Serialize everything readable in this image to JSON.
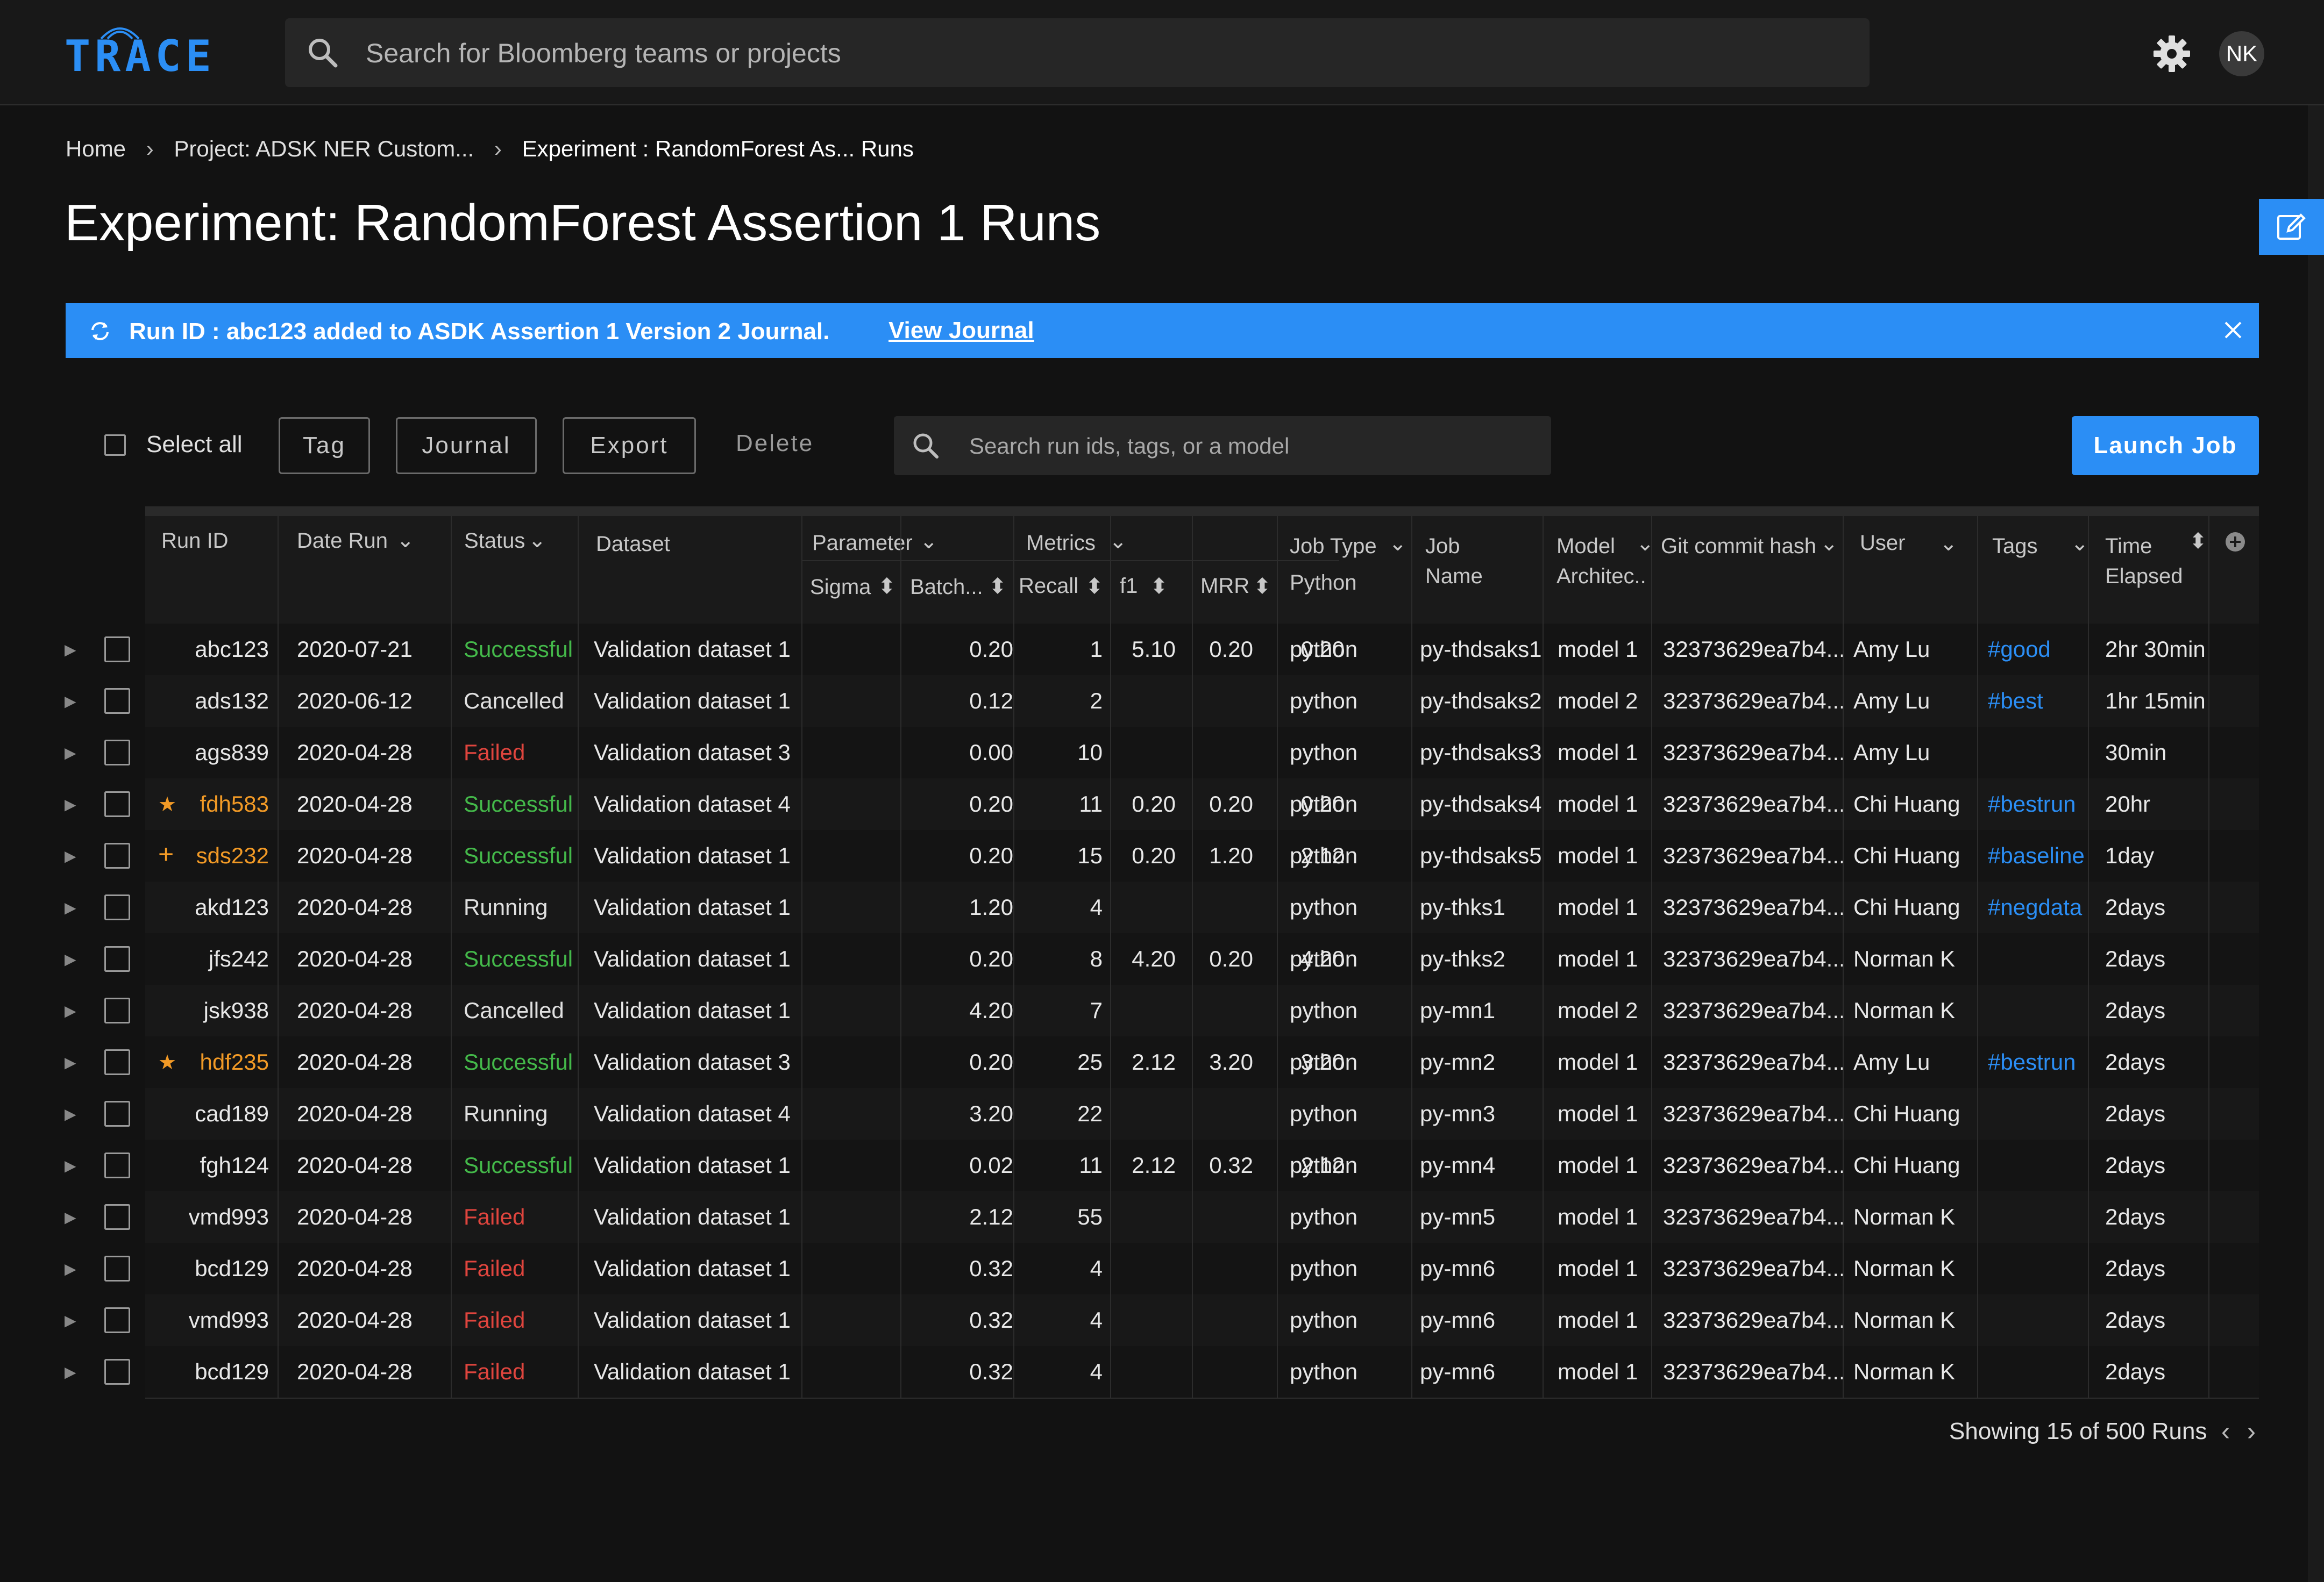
{
  "app": {
    "logo": "TRACE",
    "search_placeholder": "Search for Bloomberg teams or projects",
    "user_initials": "NK"
  },
  "breadcrumb": {
    "home": "Home",
    "project": "Project: ADSK NER Custom...",
    "experiment": "Experiment : RandomForest As... Runs"
  },
  "page": {
    "title": "Experiment: RandomForest Assertion 1 Runs"
  },
  "banner": {
    "message": "Run ID : abc123 added to ASDK Assertion 1 Version 2 Journal.",
    "link": "View Journal"
  },
  "toolbar": {
    "select_all": "Select all",
    "tag": "Tag",
    "journal": "Journal",
    "export": "Export",
    "delete": "Delete",
    "search_placeholder": "Search run ids, tags, or a model",
    "launch": "Launch Job"
  },
  "columns": {
    "run_id": "Run ID",
    "date_run": "Date Run",
    "status": "Status",
    "dataset": "Dataset",
    "parameter": "Parameter",
    "sigma": "Sigma",
    "batch": "Batch...",
    "metrics": "Metrics",
    "recall": "Recall",
    "f1": "f1",
    "mrr": "MRR",
    "job_type": "Job Type",
    "job_type_sub": "Python",
    "job_name_1": "Job",
    "job_name_2": "Name",
    "model_1": "Model",
    "model_2": "Architec..",
    "git": "Git commit hash",
    "user": "User",
    "tags": "Tags",
    "time_1": "Time",
    "time_2": "Elapsed"
  },
  "rows": [
    {
      "run_id": "abc123",
      "marker": "",
      "date": "2020-07-21",
      "status": "Successful",
      "status_kind": "success",
      "dataset": "Validation dataset 1",
      "sigma": "0.20",
      "batch": "1",
      "recall": "5.10",
      "f1": "0.20",
      "mrr": "0.20",
      "job_type": "python",
      "job_name": "py-thdsaks1",
      "model": "model 1",
      "git": "32373629ea7b4...",
      "user": "Amy Lu",
      "tag": "#good",
      "time": "2hr 30min"
    },
    {
      "run_id": "ads132",
      "marker": "",
      "date": "2020-06-12",
      "status": "Cancelled",
      "status_kind": "cancel",
      "dataset": "Validation dataset 1",
      "sigma": "0.12",
      "batch": "2",
      "recall": "",
      "f1": "",
      "mrr": "",
      "job_type": "python",
      "job_name": "py-thdsaks2",
      "model": "model 2",
      "git": "32373629ea7b4...",
      "user": "Amy Lu",
      "tag": "#best",
      "time": "1hr 15min"
    },
    {
      "run_id": "ags839",
      "marker": "",
      "date": "2020-04-28",
      "status": "Failed",
      "status_kind": "failed",
      "dataset": "Validation dataset 3",
      "sigma": "0.00",
      "batch": "10",
      "recall": "",
      "f1": "",
      "mrr": "",
      "job_type": "python",
      "job_name": "py-thdsaks3",
      "model": "model 1",
      "git": "32373629ea7b4...",
      "user": "Amy Lu",
      "tag": "",
      "time": "30min"
    },
    {
      "run_id": "fdh583",
      "marker": "★",
      "date": "2020-04-28",
      "status": "Successful",
      "status_kind": "success",
      "dataset": "Validation dataset 4",
      "sigma": "0.20",
      "batch": "11",
      "recall": "0.20",
      "f1": "0.20",
      "mrr": "0.20",
      "job_type": "python",
      "job_name": "py-thdsaks4",
      "model": "model 1",
      "git": "32373629ea7b4...",
      "user": "Chi Huang",
      "tag": "#bestrun",
      "time": "20hr"
    },
    {
      "run_id": "sds232",
      "marker": "+",
      "date": "2020-04-28",
      "status": "Successful",
      "status_kind": "success",
      "dataset": "Validation dataset 1",
      "sigma": "0.20",
      "batch": "15",
      "recall": "0.20",
      "f1": "1.20",
      "mrr": "2.12",
      "job_type": "python",
      "job_name": "py-thdsaks5",
      "model": "model 1",
      "git": "32373629ea7b4...",
      "user": "Chi Huang",
      "tag": "#baseline",
      "time": "1day"
    },
    {
      "run_id": "akd123",
      "marker": "",
      "date": "2020-04-28",
      "status": "Running",
      "status_kind": "run",
      "dataset": "Validation dataset 1",
      "sigma": "1.20",
      "batch": "4",
      "recall": "",
      "f1": "",
      "mrr": "",
      "job_type": "python",
      "job_name": "py-thks1",
      "model": "model 1",
      "git": "32373629ea7b4...",
      "user": "Chi Huang",
      "tag": "#negdata",
      "time": "2days"
    },
    {
      "run_id": "jfs242",
      "marker": "",
      "date": "2020-04-28",
      "status": "Successful",
      "status_kind": "success",
      "dataset": "Validation dataset 1",
      "sigma": "0.20",
      "batch": "8",
      "recall": "4.20",
      "f1": "0.20",
      "mrr": "4.20",
      "job_type": "python",
      "job_name": "py-thks2",
      "model": "model 1",
      "git": "32373629ea7b4...",
      "user": "Norman K",
      "tag": "",
      "time": "2days"
    },
    {
      "run_id": "jsk938",
      "marker": "",
      "date": "2020-04-28",
      "status": "Cancelled",
      "status_kind": "cancel",
      "dataset": "Validation dataset 1",
      "sigma": "4.20",
      "batch": "7",
      "recall": "",
      "f1": "",
      "mrr": "",
      "job_type": "python",
      "job_name": "py-mn1",
      "model": "model 2",
      "git": "32373629ea7b4...",
      "user": "Norman K",
      "tag": "",
      "time": "2days"
    },
    {
      "run_id": "hdf235",
      "marker": "★",
      "date": "2020-04-28",
      "status": "Successful",
      "status_kind": "success",
      "dataset": "Validation dataset 3",
      "sigma": "0.20",
      "batch": "25",
      "recall": "2.12",
      "f1": "3.20",
      "mrr": "3.20",
      "job_type": "python",
      "job_name": "py-mn2",
      "model": "model 1",
      "git": "32373629ea7b4...",
      "user": "Amy Lu",
      "tag": "#bestrun",
      "time": "2days"
    },
    {
      "run_id": "cad189",
      "marker": "",
      "date": "2020-04-28",
      "status": "Running",
      "status_kind": "run",
      "dataset": "Validation dataset 4",
      "sigma": "3.20",
      "batch": "22",
      "recall": "",
      "f1": "",
      "mrr": "",
      "job_type": "python",
      "job_name": "py-mn3",
      "model": "model 1",
      "git": "32373629ea7b4...",
      "user": "Chi Huang",
      "tag": "",
      "time": "2days"
    },
    {
      "run_id": "fgh124",
      "marker": "",
      "date": "2020-04-28",
      "status": "Successful",
      "status_kind": "success",
      "dataset": "Validation dataset 1",
      "sigma": "0.02",
      "batch": "11",
      "recall": "2.12",
      "f1": "0.32",
      "mrr": "2.12",
      "job_type": "python",
      "job_name": "py-mn4",
      "model": "model 1",
      "git": "32373629ea7b4...",
      "user": "Chi Huang",
      "tag": "",
      "time": "2days"
    },
    {
      "run_id": "vmd993",
      "marker": "",
      "date": "2020-04-28",
      "status": "Failed",
      "status_kind": "failed",
      "dataset": "Validation dataset 1",
      "sigma": "2.12",
      "batch": "55",
      "recall": "",
      "f1": "",
      "mrr": "",
      "job_type": "python",
      "job_name": "py-mn5",
      "model": "model 1",
      "git": "32373629ea7b4...",
      "user": "Norman K",
      "tag": "",
      "time": "2days"
    },
    {
      "run_id": "bcd129",
      "marker": "",
      "date": "2020-04-28",
      "status": "Failed",
      "status_kind": "failed",
      "dataset": "Validation dataset 1",
      "sigma": "0.32",
      "batch": "4",
      "recall": "",
      "f1": "",
      "mrr": "",
      "job_type": "python",
      "job_name": "py-mn6",
      "model": "model 1",
      "git": "32373629ea7b4...",
      "user": "Norman K",
      "tag": "",
      "time": "2days"
    },
    {
      "run_id": "vmd993",
      "marker": "",
      "date": "2020-04-28",
      "status": "Failed",
      "status_kind": "failed",
      "dataset": "Validation dataset 1",
      "sigma": "0.32",
      "batch": "4",
      "recall": "",
      "f1": "",
      "mrr": "",
      "job_type": "python",
      "job_name": "py-mn6",
      "model": "model 1",
      "git": "32373629ea7b4...",
      "user": "Norman K",
      "tag": "",
      "time": "2days"
    },
    {
      "run_id": "bcd129",
      "marker": "",
      "date": "2020-04-28",
      "status": "Failed",
      "status_kind": "failed",
      "dataset": "Validation dataset 1",
      "sigma": "0.32",
      "batch": "4",
      "recall": "",
      "f1": "",
      "mrr": "",
      "job_type": "python",
      "job_name": "py-mn6",
      "model": "model 1",
      "git": "32373629ea7b4...",
      "user": "Norman K",
      "tag": "",
      "time": "2days"
    }
  ],
  "footer": {
    "showing": "Showing 15 of 500 Runs"
  },
  "colors": {
    "accent": "#2b8ef5",
    "success": "#44b94a",
    "failed": "#e0453e",
    "highlight": "#f29a26",
    "background": "#121212"
  },
  "icons": [
    "search-icon",
    "gear-icon",
    "edit-icon",
    "sync-icon",
    "close-icon",
    "chevron-down-icon",
    "sort-icon",
    "add-column-icon",
    "expand-icon",
    "star-icon",
    "plus-icon",
    "chevron-left-icon",
    "chevron-right-icon"
  ]
}
